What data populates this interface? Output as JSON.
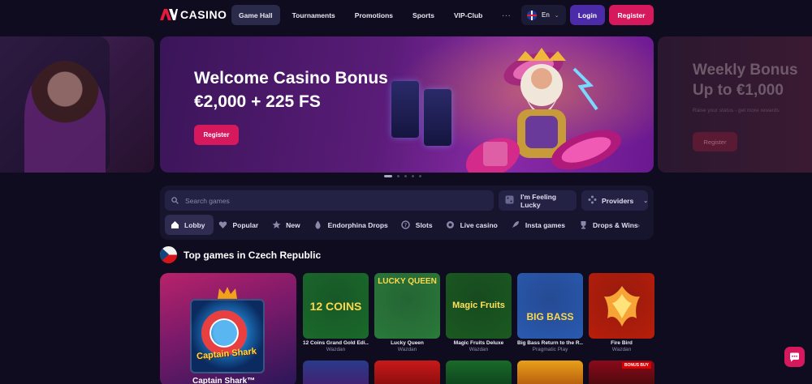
{
  "header": {
    "logo_text": "CASINO",
    "nav": [
      {
        "label": "Game Hall",
        "active": true
      },
      {
        "label": "Tournaments"
      },
      {
        "label": "Promotions"
      },
      {
        "label": "Sports"
      },
      {
        "label": "VIP-Club"
      }
    ],
    "more_label": "···",
    "language": "En",
    "login_label": "Login",
    "register_label": "Register"
  },
  "banner": {
    "title_line1": "Welcome Casino Bonus",
    "title_line2": "€2,000 + 225 FS",
    "button_label": "Register",
    "slide_count": 5,
    "active_slide": 1
  },
  "next_banner": {
    "title_line1": "Weekly Bonus",
    "title_line2": "Up to €1,000",
    "subtitle": "Raise your status - get more rewards",
    "button_label": "Register"
  },
  "search": {
    "placeholder": "Search games",
    "feeling_lucky_label": "I'm Feeling Lucky",
    "providers_label": "Providers"
  },
  "categories": [
    {
      "label": "Lobby",
      "icon": "home-icon",
      "active": true
    },
    {
      "label": "Popular",
      "icon": "heart-icon"
    },
    {
      "label": "New",
      "icon": "star-icon"
    },
    {
      "label": "Endorphina Drops",
      "icon": "drops-icon"
    },
    {
      "label": "Slots",
      "icon": "slots-icon"
    },
    {
      "label": "Live casino",
      "icon": "live-icon"
    },
    {
      "label": "Insta games",
      "icon": "rocket-icon"
    },
    {
      "label": "Drops & Wins",
      "icon": "trophy-icon"
    }
  ],
  "top_games": {
    "title": "Top games in Czech Republic",
    "featured": {
      "name": "Captain Shark™",
      "art_text": "Captain Shark"
    },
    "games": [
      {
        "name": "12 Coins Grand Gold Edi...",
        "provider": "Wazdan",
        "art": "12 COINS",
        "bg": "#1a6a2a",
        "fg": "#ffd84a"
      },
      {
        "name": "Lucky Queen",
        "provider": "Wazdan",
        "art": "LUCKY QUEEN",
        "bg": "#2a7a3a",
        "fg": "#ffd84a"
      },
      {
        "name": "Magic Fruits Deluxe",
        "provider": "Wazdan",
        "art": "Magic Fruits",
        "bg": "#1a5a20",
        "fg": "#ffe25a"
      },
      {
        "name": "Big Bass Return to the R...",
        "provider": "Pragmatic Play",
        "art": "BIG BASS",
        "bg": "#2a5ab0",
        "fg": "#ffd84a"
      },
      {
        "name": "Fire Bird",
        "provider": "Wazdan",
        "art": "",
        "bg": "#b81e0a",
        "fg": "#ffd84a"
      }
    ],
    "second_row_bonus_tag": "BONUS BUY"
  },
  "colors": {
    "accent": "#d6185c",
    "login": "#4b2ba8",
    "background": "#0f0c1f"
  }
}
